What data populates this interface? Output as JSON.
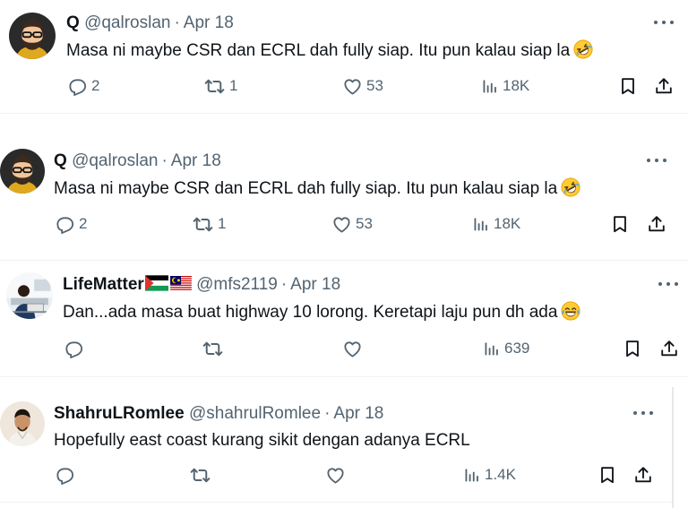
{
  "tweets": [
    {
      "name": "Q",
      "handle": "@qalroslan",
      "date": "Apr 18",
      "text": "Masa ni maybe CSR dan ECRL dah fully siap. Itu pun kalau siap la",
      "replies": "2",
      "reposts": "1",
      "likes": "53",
      "views": "18K"
    },
    {
      "name": "Q",
      "handle": "@qalroslan",
      "date": "Apr 18",
      "text": "Masa ni maybe CSR dan ECRL dah fully siap. Itu pun kalau siap la",
      "replies": "2",
      "reposts": "1",
      "likes": "53",
      "views": "18K"
    },
    {
      "name": "LifeMatter",
      "handle": "@mfs2119",
      "date": "Apr 18",
      "text": "Dan...ada masa buat highway 10 lorong. Keretapi laju pun dh ada",
      "replies": "",
      "reposts": "",
      "likes": "",
      "views": "639"
    },
    {
      "name": "ShahruLRomlee",
      "handle": "@shahrulRomlee",
      "date": "Apr 18",
      "text": "Hopefully east coast kurang sikit dengan adanya ECRL",
      "replies": "",
      "reposts": "",
      "likes": "",
      "views": "1.4K"
    }
  ],
  "separator": "·",
  "icons": {
    "reply": "speech-bubble-icon",
    "repost": "repost-arrows-icon",
    "like": "heart-icon",
    "views": "bar-chart-icon",
    "bookmark": "bookmark-icon",
    "share": "share-upload-icon",
    "more": "more-dots-icon",
    "emoji_rofl": "rolling-laughing-emoji",
    "emoji_joy": "tears-of-joy-emoji",
    "flag_palestine": "palestine-flag",
    "flag_malaysia": "malaysia-flag"
  },
  "colors": {
    "text": "#0f1419",
    "muted": "#536471",
    "divider": "#eff3f4"
  }
}
